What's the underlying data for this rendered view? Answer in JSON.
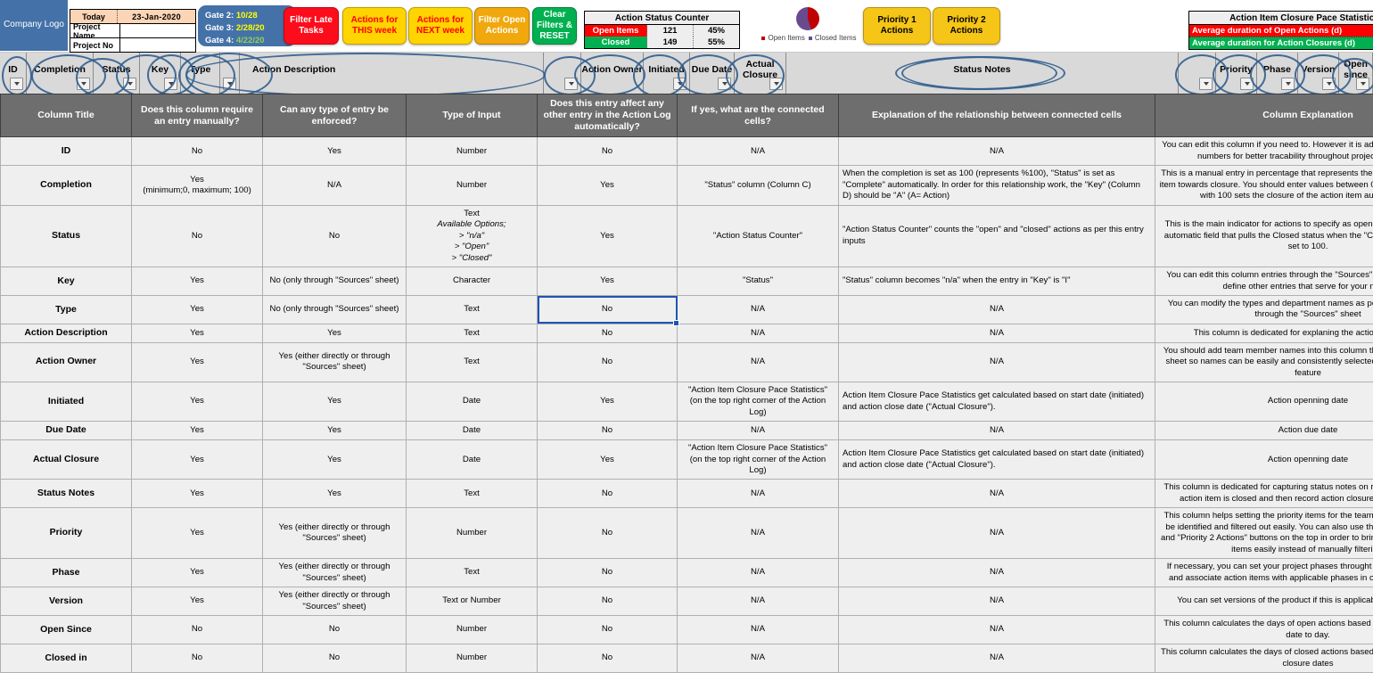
{
  "toolbar": {
    "logo": "Company Logo",
    "today_label": "Today",
    "today_value": "23-Jan-2020",
    "project_name_label": "Project Name",
    "project_name_value": "",
    "project_no_label": "Project No",
    "project_no_value": "",
    "gates": [
      {
        "label": "Gate 2:",
        "date": "10/28"
      },
      {
        "label": "Gate 3:",
        "date": "2/28/20"
      },
      {
        "label": "Gate 4:",
        "date": "4/22/20"
      }
    ],
    "buttons": {
      "filter_late": "Filter Late Tasks",
      "actions_this_week": "Actions for THIS week",
      "actions_next_week": "Actions for NEXT week",
      "filter_open": "Filter Open Actions",
      "clear_filters": "Clear Filters & RESET",
      "priority1": "Priority 1 Actions",
      "priority2": "Priority 2 Actions"
    },
    "status_counter": {
      "title": "Action Status Counter",
      "rows": [
        {
          "label": "Open Items",
          "count": "121",
          "percent": "45%"
        },
        {
          "label": "Closed",
          "count": "149",
          "percent": "55%"
        }
      ]
    },
    "pie_legend": [
      "Open Items",
      "Closed Items"
    ],
    "pace_stats": {
      "title": "Action Item Closure Pace Statistics",
      "rows": [
        "Average duration of Open Actions (d)",
        "Average duration for Action Closures (d)"
      ]
    }
  },
  "filterbar": {
    "columns": [
      {
        "name": "ID",
        "label": "ID"
      },
      {
        "name": "Completion",
        "label": "Completion"
      },
      {
        "name": "Status",
        "label": "Status"
      },
      {
        "name": "Key",
        "label": "Key"
      },
      {
        "name": "Type",
        "label": "Type"
      },
      {
        "name": "Action Description",
        "label": "Action Description"
      },
      {
        "name": "Action Owner",
        "label": "Action Owner"
      },
      {
        "name": "Initiated",
        "label": "Initiated"
      },
      {
        "name": "Due Date",
        "label": "Due Date"
      },
      {
        "name": "Actual Closure",
        "label": "Actual Closure"
      },
      {
        "name": "Status Notes",
        "label": "Status Notes"
      },
      {
        "name": "Priority",
        "label": "Priority"
      },
      {
        "name": "Phase",
        "label": "Phase"
      },
      {
        "name": "Version",
        "label": "Version"
      },
      {
        "name": "Open since",
        "label": "Open since"
      }
    ]
  },
  "table": {
    "headers": [
      "Column Title",
      "Does this column require an entry manually?",
      "Can any type of entry be enforced?",
      "Type of Input",
      "Does this entry affect any other entry in the Action Log automatically?",
      "If yes, what are the connected cells?",
      "Explanation of the relationship between connected cells",
      "Column Explanation"
    ],
    "rows": [
      {
        "title": "ID",
        "manual": "No",
        "enforced": "Yes",
        "type": "Number",
        "affects": "No",
        "connected": "N/A",
        "relationship": "N/A",
        "explanation": "You can edit this column if you need to. However it is advised to not to edit ID numbers for better tracability throughout project execution."
      },
      {
        "title": "Completion",
        "manual": "Yes\n(minimum;0, maximum; 100)",
        "enforced": "N/A",
        "type": "Number",
        "affects": "Yes",
        "connected": "\"Status\" column (Column C)",
        "relationship": "When the completion is set as 100 (represents %100), \"Status\" is set as \"Complete\" automatically. In order for this relationship work, the \"Key\" (Column D) should be \"A\" (A= Action)",
        "explanation": "This is a manual entry in percentage that represents the progress of an action item towards closure. You should enter values between 0 to 100 in this column with 100 sets the closure of the action item automatically."
      },
      {
        "title": "Status",
        "manual": "No",
        "enforced": "No",
        "type": "Text",
        "type_options_label": "Available Options;",
        "type_options": [
          "> \"n/a\"",
          "> \"Open\"",
          "> \"Closed\""
        ],
        "affects": "Yes",
        "connected": "\"Action Status Counter\"",
        "relationship": "\"Action Status Counter\" counts the \"open\" and \"closed\" actions as per this entry inputs",
        "explanation": "This is the main indicator for actions to specify as open or closed. This is an automatic field that pulls the Closed status when the \"Completion\" column is set to 100."
      },
      {
        "title": "Key",
        "manual": "Yes",
        "enforced": "No (only through \"Sources\" sheet)",
        "type": "Character",
        "affects": "Yes",
        "connected": "\"Status\"",
        "relationship": "\"Status\" column becomes \"n/a\" when the entry in \"Key\" is \"I\"",
        "explanation": "You can edit this column entries through the \"Sources\" sheet if you need to define other entries that serve for your needs"
      },
      {
        "title": "Type",
        "manual": "Yes",
        "enforced": "No (only through \"Sources\" sheet)",
        "type": "Text",
        "affects": "No",
        "affects_selected": true,
        "connected": "N/A",
        "relationship": "N/A",
        "explanation": "You can modify the types and department names as per you specific need through the \"Sources\" sheet"
      },
      {
        "title": "Action Description",
        "manual": "Yes",
        "enforced": "Yes",
        "type": "Text",
        "affects": "No",
        "connected": "N/A",
        "relationship": "N/A",
        "explanation": "This column is dedicated for explaning the action description"
      },
      {
        "title": "Action Owner",
        "manual": "Yes",
        "enforced": "Yes (either directly or through \"Sources\" sheet)",
        "type": "Text",
        "affects": "No",
        "connected": "N/A",
        "relationship": "N/A",
        "explanation": "You should add team member names into this column through the \"Sources\" sheet so names can be easily and consistently selected through drop down feature"
      },
      {
        "title": "Initiated",
        "manual": "Yes",
        "enforced": "Yes",
        "type": "Date",
        "affects": "Yes",
        "connected": "\"Action Item Closure Pace Statistics\" (on the top right corner of the Action Log)",
        "relationship": "Action Item Closure Pace Statistics get calculated based on start date (initiated) and action close date (\"Actual Closure\").",
        "explanation": "Action openning date"
      },
      {
        "title": "Due Date",
        "manual": "Yes",
        "enforced": "Yes",
        "type": "Date",
        "affects": "No",
        "connected": "N/A",
        "relationship": "N/A",
        "explanation": "Action due date"
      },
      {
        "title": "Actual Closure",
        "manual": "Yes",
        "enforced": "Yes",
        "type": "Date",
        "affects": "Yes",
        "connected": "\"Action Item Closure Pace Statistics\" (on the top right corner of the Action Log)",
        "relationship": "Action Item Closure Pace Statistics get calculated based on start date (initiated) and action close date (\"Actual Closure\").",
        "explanation": "Action openning date"
      },
      {
        "title": "Status Notes",
        "manual": "Yes",
        "enforced": "Yes",
        "type": "Text",
        "affects": "No",
        "connected": "N/A",
        "relationship": "N/A",
        "explanation": "This column is dedicated for capturing status notes on regular basis until the action item is closed and then record action closure notes as history"
      },
      {
        "title": "Priority",
        "manual": "Yes",
        "enforced": "Yes (either directly or through \"Sources\" sheet)",
        "type": "Number",
        "affects": "No",
        "connected": "N/A",
        "relationship": "N/A",
        "explanation": "This column helps setting the priority items for the team so priority items can be identified and filtered out easily. You can also use the \"Priority 1 Actions\" and \"Priority 2 Actions\" buttons on the top in order to bring upon Priority 1 or 2 items easily instead of manually filtering."
      },
      {
        "title": "Phase",
        "manual": "Yes",
        "enforced": "Yes (either directly or through \"Sources\" sheet)",
        "type": "Text",
        "affects": "No",
        "connected": "N/A",
        "relationship": "N/A",
        "explanation": "If necessary, you can set your project phases throught the \"Sources\" sheet and associate action items with applicable phases in order to group them."
      },
      {
        "title": "Version",
        "manual": "Yes",
        "enforced": "Yes (either directly or through \"Sources\" sheet)",
        "type": "Text or Number",
        "affects": "No",
        "connected": "N/A",
        "relationship": "N/A",
        "explanation": "You can set versions of the product if this is applicable to your project"
      },
      {
        "title": "Open Since",
        "manual": "No",
        "enforced": "No",
        "type": "Number",
        "affects": "No",
        "connected": "N/A",
        "relationship": "N/A",
        "explanation": "This column calculates the days of open actions based off initiation date and date to day."
      },
      {
        "title": "Closed in",
        "manual": "No",
        "enforced": "No",
        "type": "Number",
        "affects": "No",
        "connected": "N/A",
        "relationship": "N/A",
        "explanation": "This column calculates the days of closed actions based off initiation date and closure dates"
      }
    ]
  },
  "colors": {
    "header_gray": "#6e6e6e",
    "cell_gray": "#efefef",
    "brand_blue": "#4472a8",
    "open_red": "#ff0000",
    "closed_green": "#00b050",
    "selection_blue": "#1d55b5"
  }
}
